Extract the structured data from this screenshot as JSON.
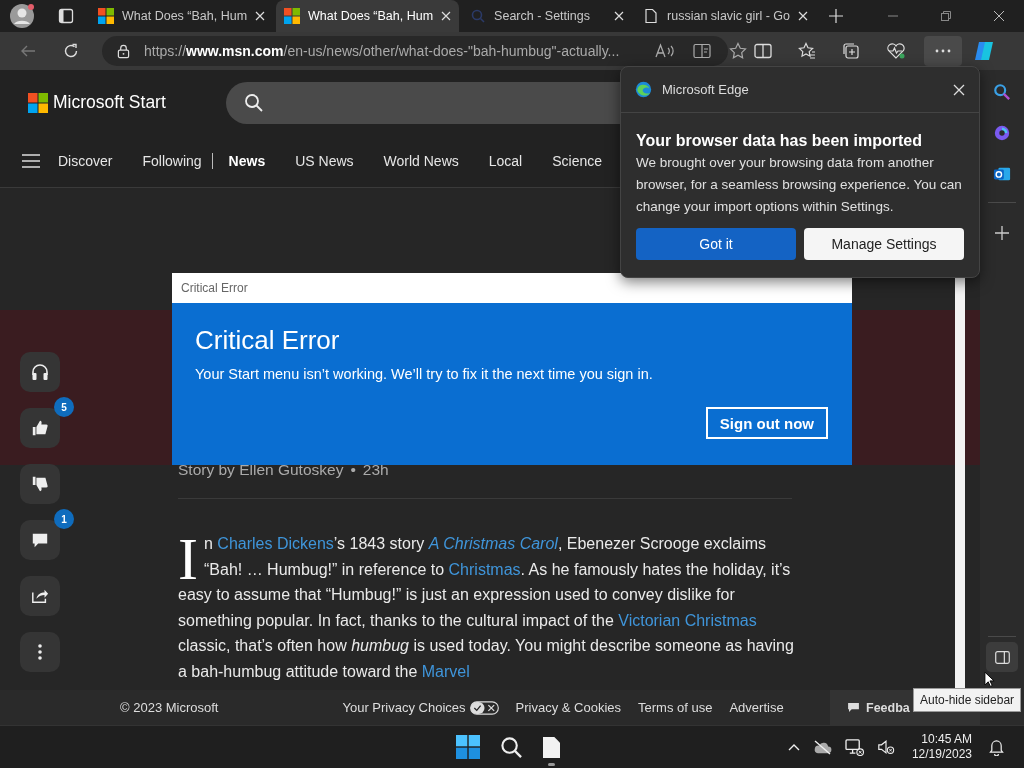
{
  "browser": {
    "tabs": [
      {
        "title": "What Does “Bah, Hum",
        "kind": "news",
        "selected": false
      },
      {
        "title": "What Does “Bah, Hum",
        "kind": "news",
        "selected": true
      },
      {
        "title": "Search - Settings",
        "kind": "search",
        "selected": false
      },
      {
        "title": "russian slavic girl - Go",
        "kind": "document",
        "selected": false
      }
    ],
    "address": "https://**www.msn.com**/en-us/news/other/what-does-\"bah-humbug\"-actually..."
  },
  "site": {
    "logo": "Microsoft Start",
    "nav": [
      {
        "label": "Discover",
        "selected": false
      },
      {
        "label": "Following",
        "selected": false
      },
      {
        "label": "News",
        "selected": true
      },
      {
        "label": "US News",
        "selected": false
      },
      {
        "label": "World News",
        "selected": false
      },
      {
        "label": "Local",
        "selected": false
      },
      {
        "label": "Science",
        "selected": false
      }
    ]
  },
  "rail": [
    {
      "kind": "listen"
    },
    {
      "kind": "like",
      "badge": "5"
    },
    {
      "kind": "dislike"
    },
    {
      "kind": "comment",
      "badge": "1"
    },
    {
      "kind": "share"
    },
    {
      "kind": "more"
    }
  ],
  "article": {
    "byline": "Story by Ellen Gutoskey",
    "separator": "•",
    "age": "23h",
    "drop_cap": "I",
    "segments": [
      {
        "kind": "text",
        "text": "n "
      },
      {
        "kind": "link",
        "text": "Charles Dickens"
      },
      {
        "kind": "text",
        "text": "’s 1843 story "
      },
      {
        "kind": "italic-link",
        "text": "A Christmas Carol"
      },
      {
        "kind": "text",
        "text": ", Ebenezer Scrooge exclaims “Bah! … Humbug!” in reference to "
      },
      {
        "kind": "link",
        "text": "Christmas"
      },
      {
        "kind": "text",
        "text": ". As he famously hates the holiday, it’s easy to assume that “Humbug!” is just an expression used to convey dislike for something popular. In fact, thanks to the cultural impact of the "
      },
      {
        "kind": "link",
        "text": "Victorian Christmas"
      },
      {
        "kind": "text",
        "text": " classic, that’s often how "
      },
      {
        "kind": "italic",
        "text": "humbug"
      },
      {
        "kind": "text",
        "text": " is used today. You might describe someone as having a bah-humbug attitude toward the "
      },
      {
        "kind": "link",
        "text": "Marvel"
      }
    ]
  },
  "footer": {
    "copyright": "© 2023 Microsoft",
    "links": [
      "Your Privacy Choices",
      "Privacy & Cookies",
      "Terms of use",
      "Advertise"
    ],
    "feedback": "Feedba"
  },
  "error_dialog": {
    "window_title": "Critical Error",
    "heading": "Critical Error",
    "message": "Your Start menu isn’t working. We’ll try to fix it the next time you sign in.",
    "button": "Sign out now"
  },
  "edge_popup": {
    "app": "Microsoft Edge",
    "heading": "Your browser data has been imported",
    "body": "We brought over your browsing data from another browser, for a seamless browsing experience. You can change your import options within Settings.",
    "primary": "Got it",
    "secondary": "Manage Settings"
  },
  "tooltip": "Auto-hide sidebar",
  "taskbar": {
    "time": "10:45 AM",
    "date": "12/19/2023"
  }
}
